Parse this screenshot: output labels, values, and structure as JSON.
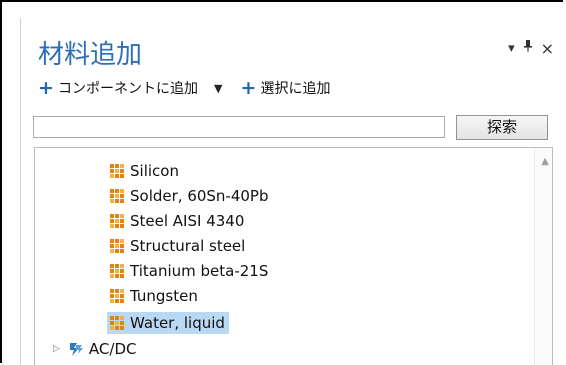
{
  "panel": {
    "title": "材料追加",
    "header_icons": {
      "dropdown": "▾",
      "pin": "pin-icon",
      "close": "×"
    }
  },
  "toolbar": {
    "add_to_component_label": "コンポーネントに追加",
    "add_to_selection_label": "選択に追加"
  },
  "search": {
    "placeholder": "",
    "value": "",
    "button_label": "探索"
  },
  "tree": {
    "partial_top_label": "...",
    "materials": [
      {
        "label": "Silicon",
        "selected": false
      },
      {
        "label": "Solder, 60Sn-40Pb",
        "selected": false
      },
      {
        "label": "Steel AISI 4340",
        "selected": false
      },
      {
        "label": "Structural steel",
        "selected": false
      },
      {
        "label": "Titanium beta-21S",
        "selected": false
      },
      {
        "label": "Tungsten",
        "selected": false
      },
      {
        "label": "Water, liquid",
        "selected": true
      }
    ],
    "folder": {
      "label": "AC/DC",
      "expander": "▷"
    }
  },
  "colors": {
    "title": "#2c6fb6",
    "plus": "#1f66b3",
    "selection": "#b9d8f3",
    "material_icon": "#e8820e"
  }
}
